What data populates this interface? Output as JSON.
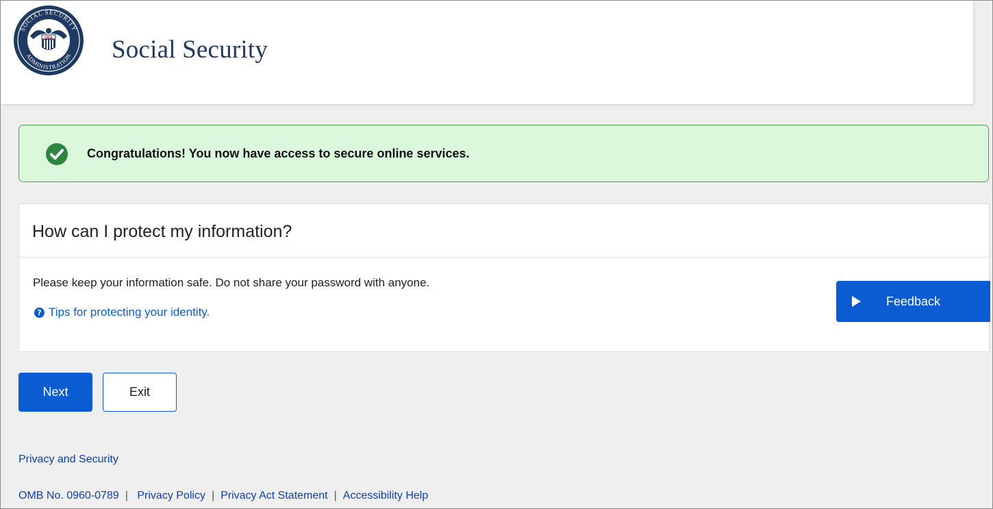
{
  "header": {
    "logo_alt": "SOCIAL SECURITY ADMINISTRATION",
    "logo_text_usa": "USA",
    "site_title": "Social Security"
  },
  "alert": {
    "message": "Congratulations! You now have access to secure online services.",
    "icon": "check-circle-icon",
    "color": "#4ba34b"
  },
  "card": {
    "title": "How can I protect my information?",
    "body": "Please keep your information safe. Do not share your password with anyone.",
    "tips_link": "Tips for protecting your identity.",
    "tips_icon": "question-circle-icon"
  },
  "feedback": {
    "label": "Feedback",
    "icon": "play-icon"
  },
  "actions": {
    "next_label": "Next",
    "exit_label": "Exit"
  },
  "footer": {
    "privacy_security": "Privacy and Security",
    "omb": "OMB No. 0960-0789",
    "separator": "|",
    "privacy_policy": "Privacy Policy",
    "privacy_act": "Privacy Act Statement",
    "accessibility": "Accessibility Help"
  },
  "colors": {
    "primary": "#0b5bd3",
    "title": "#1f3a62",
    "alert_bg": "#dcf8dc"
  }
}
